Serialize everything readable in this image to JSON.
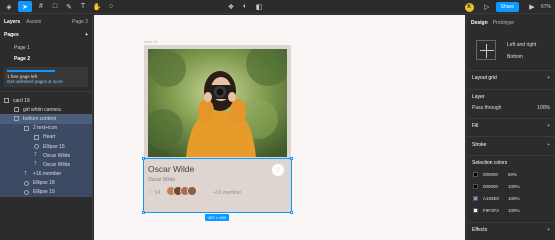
{
  "toolbar": {
    "avatar_letter": "K",
    "share_label": "Share",
    "zoom": "67%"
  },
  "left_panel": {
    "tabs": {
      "layers": "Layers",
      "assets": "Assets",
      "page": "Page 2"
    },
    "pages_title": "Pages",
    "pages": [
      "Page 1",
      "Page 2"
    ],
    "notice_line1": "1 free page left",
    "notice_line2": "Get unlimited pages & more",
    "layers": [
      {
        "label": "card 19",
        "indent": 4,
        "icon": "frame",
        "sel": ""
      },
      {
        "label": "girl whitn camera",
        "indent": 14,
        "icon": "image",
        "sel": ""
      },
      {
        "label": "bottom content",
        "indent": 14,
        "icon": "frame",
        "sel": "strong"
      },
      {
        "label": "2 text+icon",
        "indent": 24,
        "icon": "frame",
        "sel": "sel"
      },
      {
        "label": "Heart",
        "indent": 34,
        "icon": "frame",
        "sel": "sel"
      },
      {
        "label": "Ellipse 15",
        "indent": 34,
        "icon": "circle",
        "sel": "sel"
      },
      {
        "label": "Oscar Wilde",
        "indent": 34,
        "icon": "txt",
        "sel": "sel"
      },
      {
        "label": "Oscar Wilde",
        "indent": 34,
        "icon": "txt",
        "sel": "sel"
      },
      {
        "label": "+16 member",
        "indent": 24,
        "icon": "txt",
        "sel": "sel"
      },
      {
        "label": "Ellipse 18",
        "indent": 24,
        "icon": "circle",
        "sel": "sel"
      },
      {
        "label": "Ellipse 19",
        "indent": 24,
        "icon": "circle",
        "sel": "sel"
      }
    ]
  },
  "canvas": {
    "frame_label": "card 19",
    "name": "Oscar Wilde",
    "role": "Oscar Wilde",
    "likes": "14",
    "members": "+16 member",
    "size_tag": "457 × 169"
  },
  "right_panel": {
    "tabs": {
      "design": "Design",
      "prototype": "Prototype"
    },
    "align_left": "Left and right",
    "align_bottom": "Bottom",
    "layout_grid": "Layout grid",
    "layer_title": "Layer",
    "passthrough": "Pass through",
    "layer_opacity": "100%",
    "fill": "Fill",
    "stroke": "Stroke",
    "selection_colors": "Selection colors",
    "colors": [
      {
        "hex": "000000",
        "pct": "50%",
        "swatch": "#000000"
      },
      {
        "hex": "000000",
        "pct": "100%",
        "swatch": "#000000"
      },
      {
        "hex": "A183E0",
        "pct": "100%",
        "swatch": "#A183E0"
      },
      {
        "hex": "F9F3F3",
        "pct": "100%",
        "swatch": "#F9F3F3"
      }
    ],
    "effects": "Effects"
  }
}
